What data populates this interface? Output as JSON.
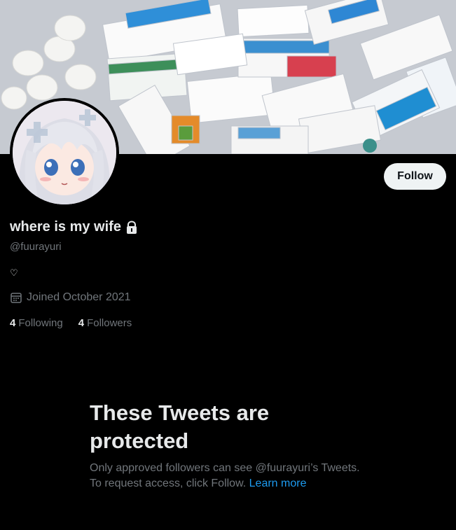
{
  "profile": {
    "display_name": "where is my wife",
    "handle": "@fuurayuri",
    "bio": "♡",
    "joined": "Joined October 2021",
    "following_count": "4",
    "following_label": "Following",
    "followers_count": "4",
    "followers_label": "Followers"
  },
  "actions": {
    "follow_label": "Follow"
  },
  "protected": {
    "title": "These Tweets are protected",
    "desc_prefix": "Only approved followers can see @fuurayuri’s Tweets. To request access, click Follow.",
    "learn_more": "Learn more"
  },
  "icons": {
    "lock": "lock-icon",
    "calendar": "calendar-icon"
  },
  "colors": {
    "background": "#000000",
    "primary_text": "#e7e9ea",
    "secondary_text": "#71767b",
    "link": "#1d9bf0",
    "follow_bg": "#eff3f4"
  }
}
